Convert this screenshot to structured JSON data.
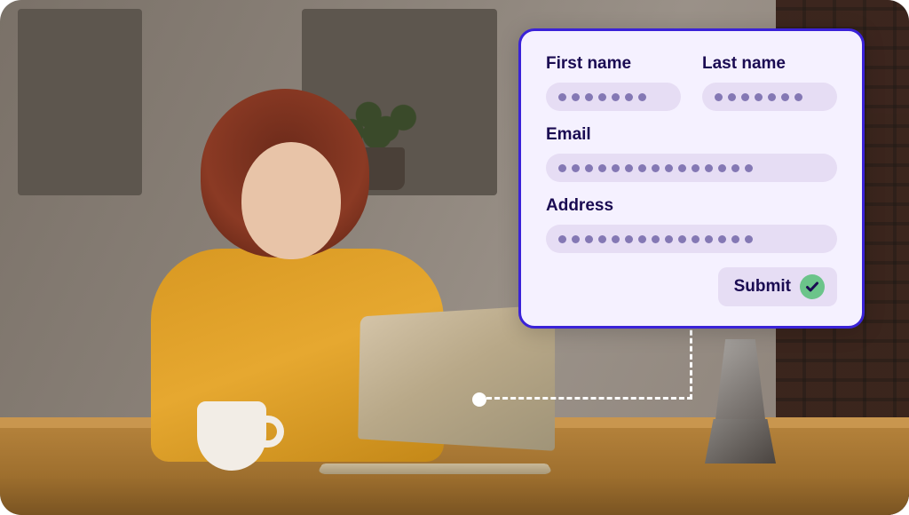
{
  "colors": {
    "card_bg": "#f5f1ff",
    "card_border": "#3a22d8",
    "label_text": "#1a0b52",
    "input_bg": "#e6ddf4",
    "dot": "#8478b4",
    "check_bg": "#6bc48a"
  },
  "form": {
    "first_name": {
      "label": "First name",
      "masked_dot_count": 7
    },
    "last_name": {
      "label": "Last name",
      "masked_dot_count": 7
    },
    "email": {
      "label": "Email",
      "masked_dot_count": 15
    },
    "address": {
      "label": "Address",
      "masked_dot_count": 15
    },
    "submit_label": "Submit"
  }
}
